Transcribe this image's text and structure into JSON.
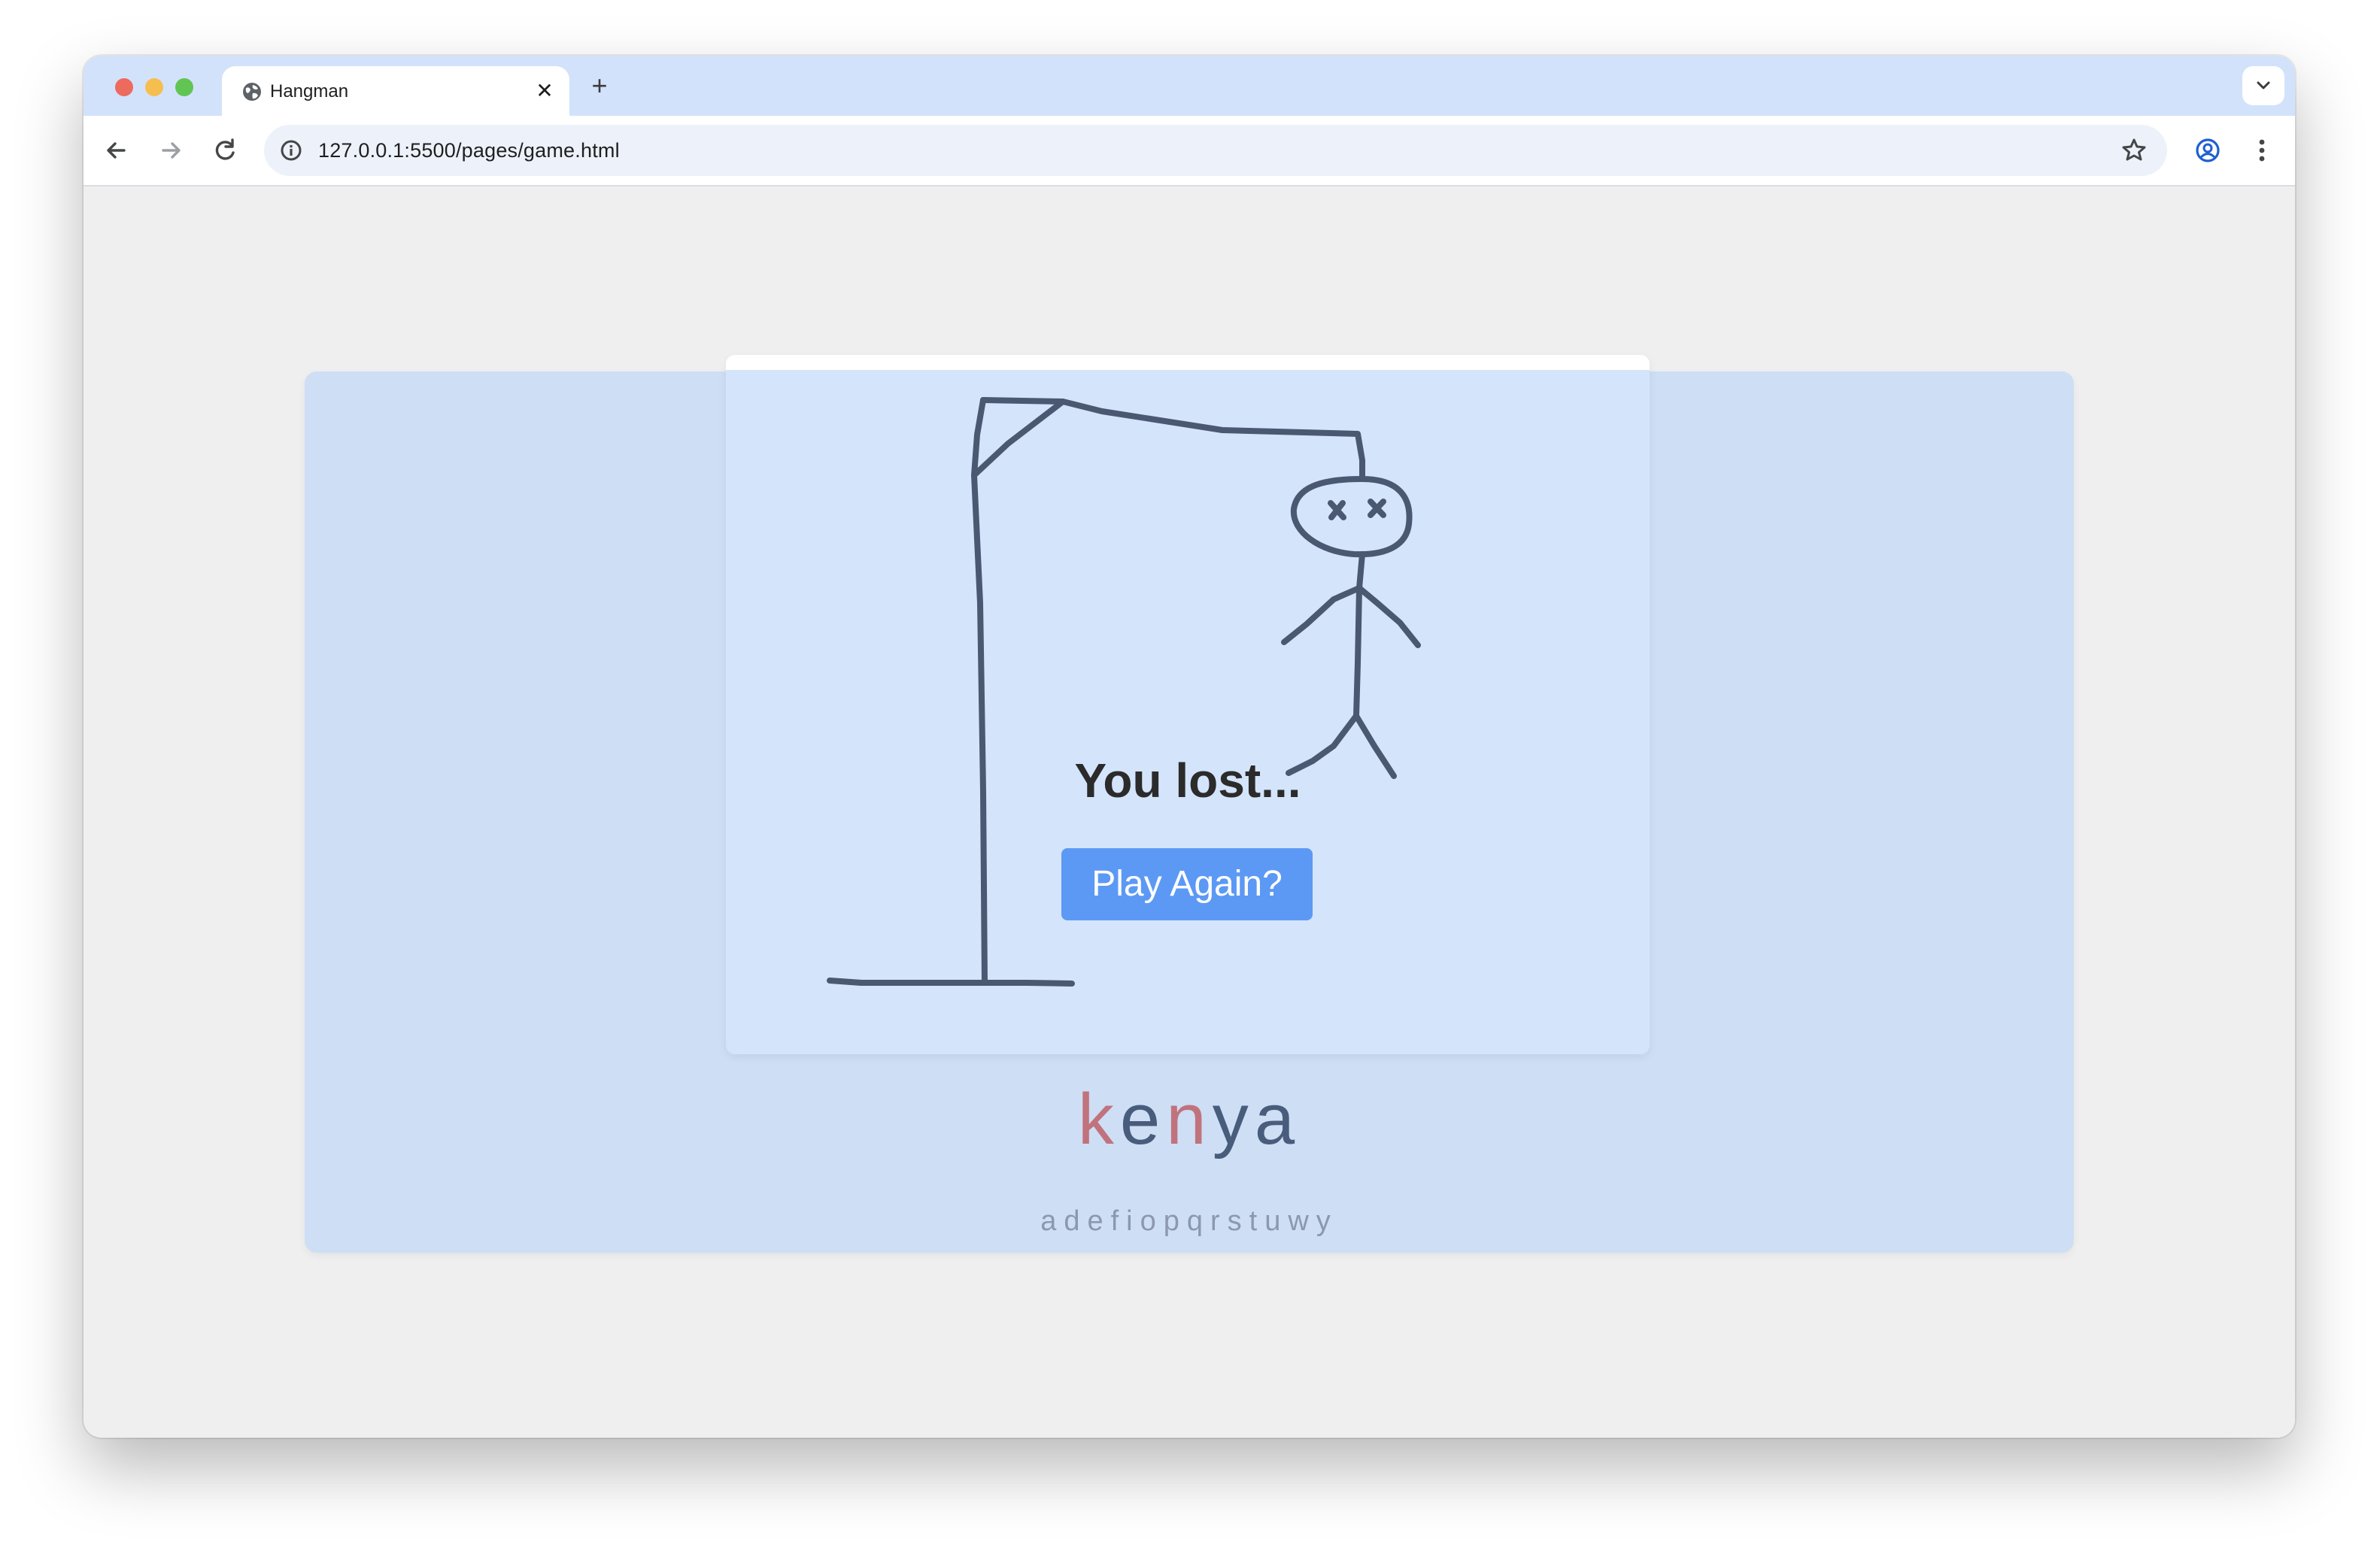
{
  "browser": {
    "tab": {
      "title": "Hangman"
    },
    "address_bar": {
      "url": "127.0.0.1:5500/pages/game.html"
    }
  },
  "game": {
    "result_message": "You lost...",
    "play_again_label": "Play Again?",
    "word_letters": [
      {
        "char": "k",
        "status": "missed"
      },
      {
        "char": "e",
        "status": "guessed"
      },
      {
        "char": "n",
        "status": "missed"
      },
      {
        "char": "y",
        "status": "guessed"
      },
      {
        "char": "a",
        "status": "guessed"
      }
    ],
    "guessed_letters": "adefiopqrstuwy",
    "colors": {
      "guessed_letter": "#485c7c",
      "missed_letter": "#c0737d",
      "button": "#5c99f4",
      "panel": "#cedef5",
      "board": "#d4e4fb",
      "stroke": "#4a5872"
    }
  }
}
